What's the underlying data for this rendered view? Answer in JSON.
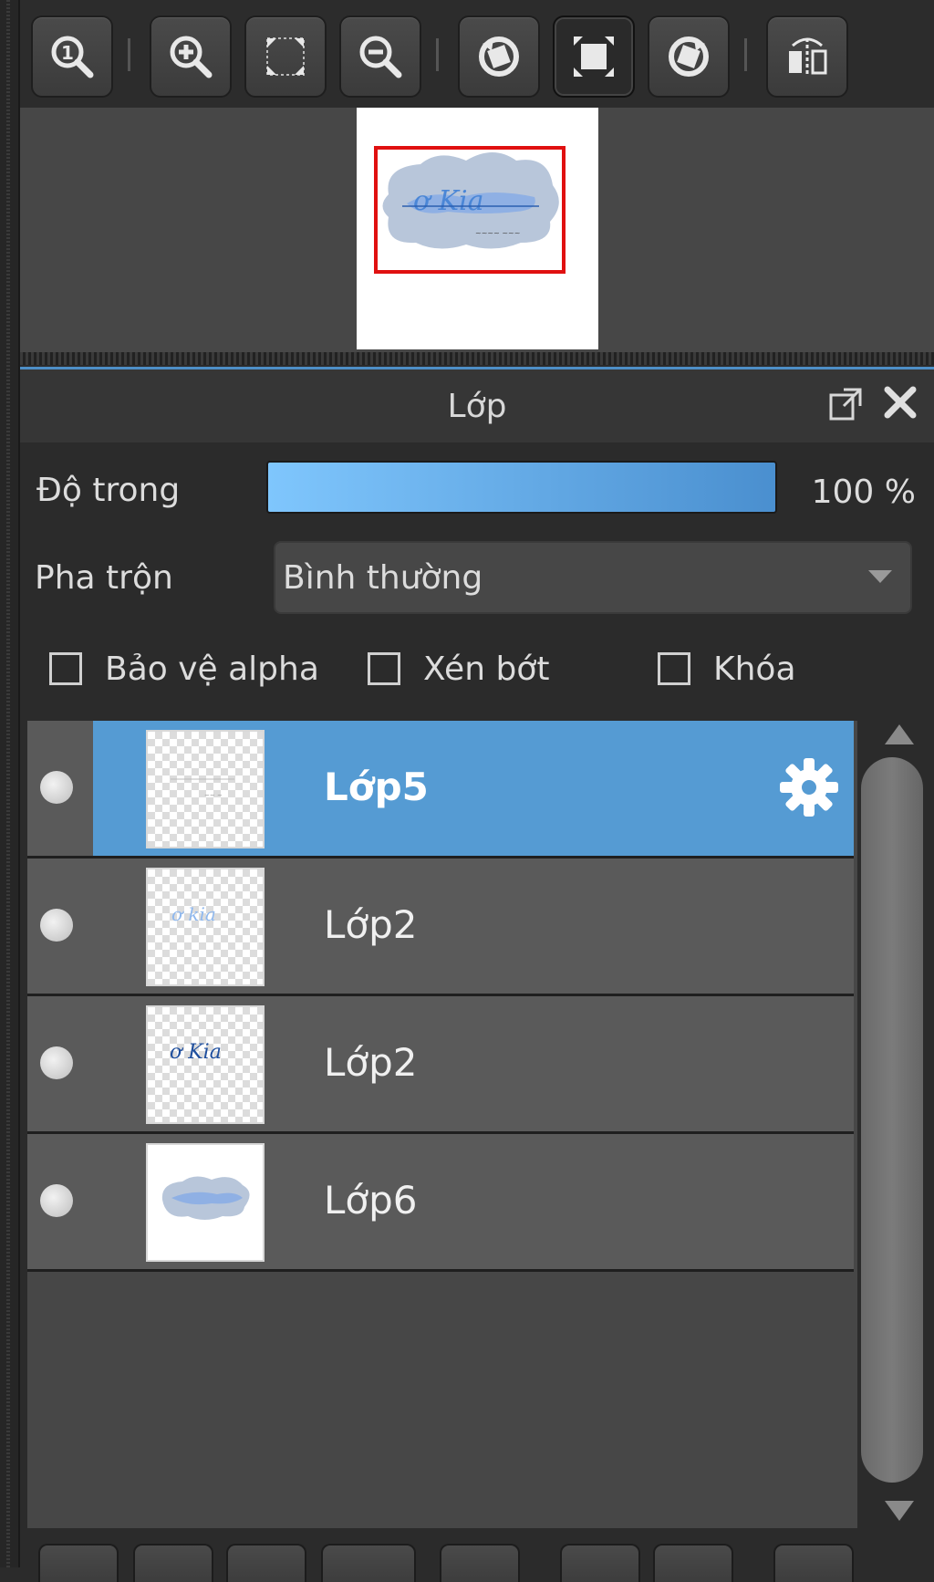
{
  "navigator": {
    "toolbar": [
      {
        "name": "zoom-actual-size-icon"
      },
      {
        "name": "zoom-in-icon"
      },
      {
        "name": "fit-to-screen-icon"
      },
      {
        "name": "zoom-out-icon"
      },
      {
        "name": "rotate-left-icon"
      },
      {
        "name": "reset-view-icon",
        "active": true
      },
      {
        "name": "rotate-right-icon"
      },
      {
        "name": "flip-horizontal-icon"
      }
    ],
    "viewport_color": "#e01010"
  },
  "layer_panel": {
    "title": "Lớp",
    "opacity_label": "Độ trong",
    "opacity_value": "100 %",
    "opacity_fraction": 1.0,
    "blend_label": "Pha trộn",
    "blend_value": "Bình thường",
    "checkboxes": [
      {
        "label": "Bảo vệ alpha",
        "checked": false
      },
      {
        "label": "Xén bớt",
        "checked": false
      },
      {
        "label": "Khóa",
        "checked": false
      }
    ],
    "layers": [
      {
        "name": "Lớp5",
        "selected": true
      },
      {
        "name": "Lớp2",
        "selected": false
      },
      {
        "name": "Lớp2",
        "selected": false
      },
      {
        "name": "Lớp6",
        "selected": false
      }
    ],
    "accent": "#559bd3"
  }
}
